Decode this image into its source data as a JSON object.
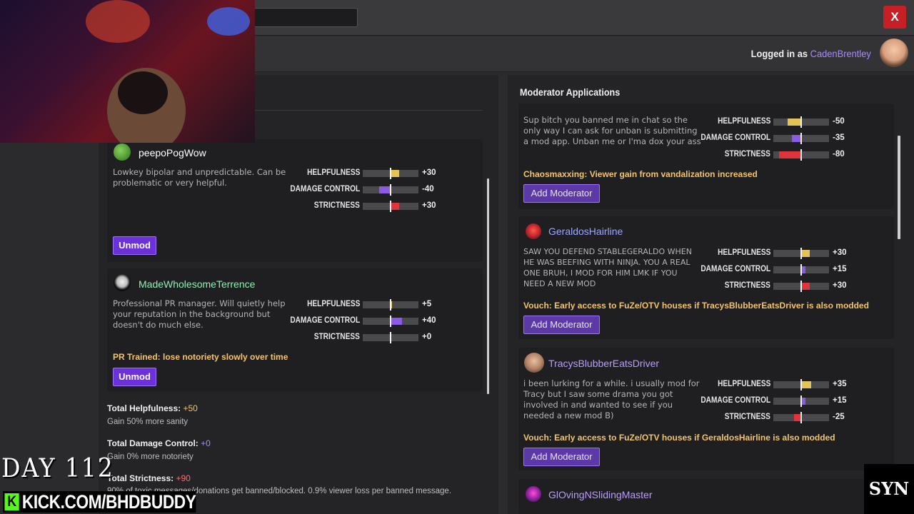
{
  "window": {
    "close_label": "X"
  },
  "header": {
    "logged_in_prefix": "Logged in as ",
    "username": "CadenBrentley"
  },
  "current_mods": [
    {
      "name": "peepoPogWow",
      "name_color": "#ffffff",
      "description": "Lowkey bipolar and unpredictable. Can be problematic or very helpful.",
      "stats": [
        {
          "label": "HELPFULNESS",
          "value": "+30",
          "level": 30
        },
        {
          "label": "DAMAGE CONTROL",
          "value": "-40",
          "level": -40
        },
        {
          "label": "STRICTNESS",
          "value": "+30",
          "level": 30
        }
      ],
      "perk": "",
      "button": "Unmod"
    },
    {
      "name": "MadeWholesomeTerrence",
      "name_color": "#8ff0b0",
      "description": "Professional PR manager. Will quietly help your reputation in the background but doesn't do much else.",
      "stats": [
        {
          "label": "HELPFULNESS",
          "value": "+5",
          "level": 5
        },
        {
          "label": "DAMAGE CONTROL",
          "value": "+40",
          "level": 40
        },
        {
          "label": "STRICTNESS",
          "value": "+0",
          "level": 0
        }
      ],
      "perk": "PR Trained: lose notoriety slowly over time",
      "button": "Unmod"
    }
  ],
  "totals": [
    {
      "label": "Total Helpfulness:",
      "value": "+50",
      "value_color": "#f4c46a",
      "sub": "Gain 50% more sanity"
    },
    {
      "label": "Total Damage Control:",
      "value": "+0",
      "value_color": "#a888ff",
      "sub": "Gain 0% more notoriety"
    },
    {
      "label": "Total Strictness:",
      "value": "+90",
      "value_color": "#ff6b6b",
      "sub": "90% of toxic messages/donations get banned/blocked. 0.9% viewer loss per banned message."
    }
  ],
  "applications": {
    "title": "Moderator Applications",
    "items": [
      {
        "name": "",
        "name_color": "#ff6b5b",
        "description": "Sup bitch you banned me in chat so the only way I can ask for unban is submitting a mod app. Unban me or I'ma dox your ass",
        "stats": [
          {
            "label": "HELPFULNESS",
            "value": "-50",
            "level": -50
          },
          {
            "label": "DAMAGE CONTROL",
            "value": "-35",
            "level": -35
          },
          {
            "label": "STRICTNESS",
            "value": "-80",
            "level": -80
          }
        ],
        "perk": "Chaosmaxxing: Viewer gain from vandalization increased",
        "button": "Add Moderator"
      },
      {
        "name": "GeraldosHairline",
        "name_color": "#9aa7ff",
        "description": "SAW YOU DEFEND STABLEGERALDO WHEN HE WAS BEEFING WITH NINJA. YOU A REAL ONE BRUH, I MOD FOR HIM LMK IF YOU NEED A NEW MOD",
        "stats": [
          {
            "label": "HELPFULNESS",
            "value": "+30",
            "level": 30
          },
          {
            "label": "DAMAGE CONTROL",
            "value": "+15",
            "level": 15
          },
          {
            "label": "STRICTNESS",
            "value": "+30",
            "level": 30
          }
        ],
        "perk": "Vouch: Early access to FuZe/OTV houses if TracysBlubberEatsDriver is also modded",
        "button": "Add Moderator"
      },
      {
        "name": "TracysBlubberEatsDriver",
        "name_color": "#b89cff",
        "description": "i been lurking for a while. i usually mod for Tracy but I saw some drama you got involved in and wanted to see if you needed a new mod B)",
        "stats": [
          {
            "label": "HELPFULNESS",
            "value": "+35",
            "level": 35
          },
          {
            "label": "DAMAGE CONTROL",
            "value": "+15",
            "level": 15
          },
          {
            "label": "STRICTNESS",
            "value": "-25",
            "level": -25
          }
        ],
        "perk": "Vouch: Early access to FuZe/OTV houses if GeraldosHairline is also modded",
        "button": "Add Moderator"
      },
      {
        "name": "GlOvingNSlidingMaster",
        "name_color": "#b89cff"
      }
    ]
  },
  "overlay": {
    "day": "DAY 112",
    "kick": "KICK.COM/BHDBUDDY",
    "logo": "SYN"
  },
  "colors": {
    "helpfulness": "#e3c25a",
    "damage_control": "#8a5ae0",
    "strictness": "#e0343c",
    "button": "#6a32d8"
  }
}
